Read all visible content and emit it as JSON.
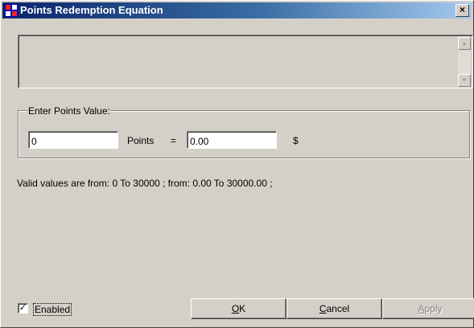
{
  "window": {
    "title": "Points Redemption Equation",
    "close_glyph": "×",
    "icon": "app-grid-icon"
  },
  "description_area": {
    "value": "",
    "scroll_up_glyph": "▲",
    "scroll_down_glyph": "▼"
  },
  "points_group": {
    "legend": "Enter Points Value:",
    "points_value": "0",
    "points_label": "Points",
    "equals_label": "=",
    "dollar_value": "0.00",
    "dollar_label": "$"
  },
  "valid_text": "Valid values are from: 0 To 30000 ; from: 0.00 To 30000.00 ;",
  "enabled": {
    "checked": true,
    "check_glyph": "✓",
    "label": "Enabled"
  },
  "buttons": {
    "ok": {
      "hotkey": "O",
      "rest": "K"
    },
    "cancel": {
      "hotkey": "C",
      "rest": "ancel"
    },
    "apply": {
      "hotkey": "A",
      "rest": "pply",
      "disabled": true
    }
  },
  "colors": {
    "titlebar_start": "#0a246a",
    "titlebar_end": "#a6caf0",
    "face": "#d4d0c8"
  }
}
